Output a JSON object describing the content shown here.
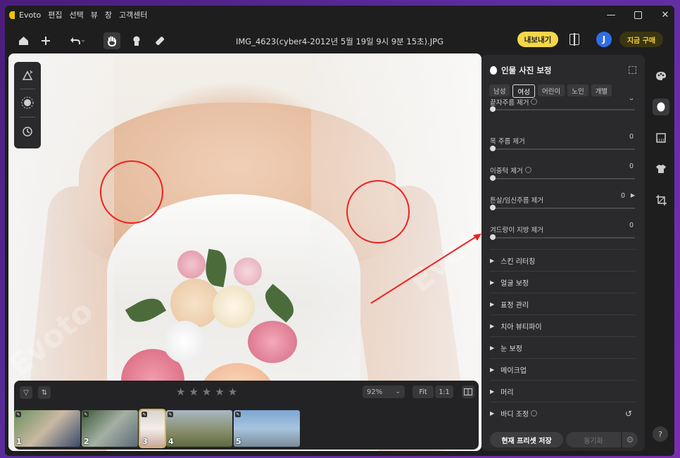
{
  "menu": {
    "app_name": "Evoto",
    "items": [
      "편집",
      "선택",
      "뷰",
      "창",
      "고객센터"
    ]
  },
  "window_controls": {
    "minimize": "—",
    "close": "✕"
  },
  "toolbar": {
    "filename": "IMG_4623(cyber4-2012년 5월 19일 9시 9분 15초).JPG",
    "export_label": "내보내기",
    "avatar_letter": "J",
    "buy_label": "지금 구매",
    "icons": [
      "home-icon",
      "plus-icon",
      "undo-icon",
      "hand-icon",
      "person-mask-icon",
      "eraser-icon"
    ]
  },
  "left_tools": {
    "icons": [
      "magic-triangle-icon",
      "radial-brightness-icon",
      "history-icon"
    ]
  },
  "filmstrip": {
    "zoom": "92%",
    "fit_label": "Fit",
    "one_to_one_label": "1:1",
    "stars": "★★★★★",
    "thumbnails": [
      {
        "num": "1",
        "selected": false
      },
      {
        "num": "2",
        "selected": false
      },
      {
        "num": "3",
        "selected": true
      },
      {
        "num": "4",
        "selected": false
      },
      {
        "num": "5",
        "selected": false
      }
    ]
  },
  "panel": {
    "title": "인물 사진 보정",
    "gender_tabs": [
      "남성",
      "여성",
      "어린이",
      "노인",
      "개별"
    ],
    "active_tab": "여성",
    "sliders": [
      {
        "label": "끝자주름 제거",
        "value": "0",
        "has_info": true,
        "has_arrow": false
      },
      {
        "label": "목 주름 제거",
        "value": "0",
        "has_info": false,
        "has_arrow": false
      },
      {
        "label": "이중턱 제거",
        "value": "0",
        "has_info": true,
        "has_arrow": false
      },
      {
        "label": "튼살/임신주름 제거",
        "value": "0",
        "has_info": false,
        "has_arrow": true
      },
      {
        "label": "겨드랑이 지방 제거",
        "value": "0",
        "has_info": false,
        "has_arrow": false
      }
    ],
    "sections": [
      "스킨 리터칭",
      "얼굴 보정",
      "표정 관리",
      "치아 뷰티파이",
      "눈 보정",
      "메이크업",
      "머리",
      "바디 조정"
    ],
    "save_label": "현재 프리셋 저장",
    "sync_label": "동기화"
  },
  "right_sidebar": {
    "icons": [
      "palette-icon",
      "portrait-icon",
      "background-icon",
      "clothing-icon",
      "crop-icon"
    ],
    "help": "?"
  },
  "watermark": "Evoto",
  "colors": {
    "accent": "#f6d64a",
    "annotation": "#e22222",
    "brand_blue": "#2f6ee8"
  }
}
